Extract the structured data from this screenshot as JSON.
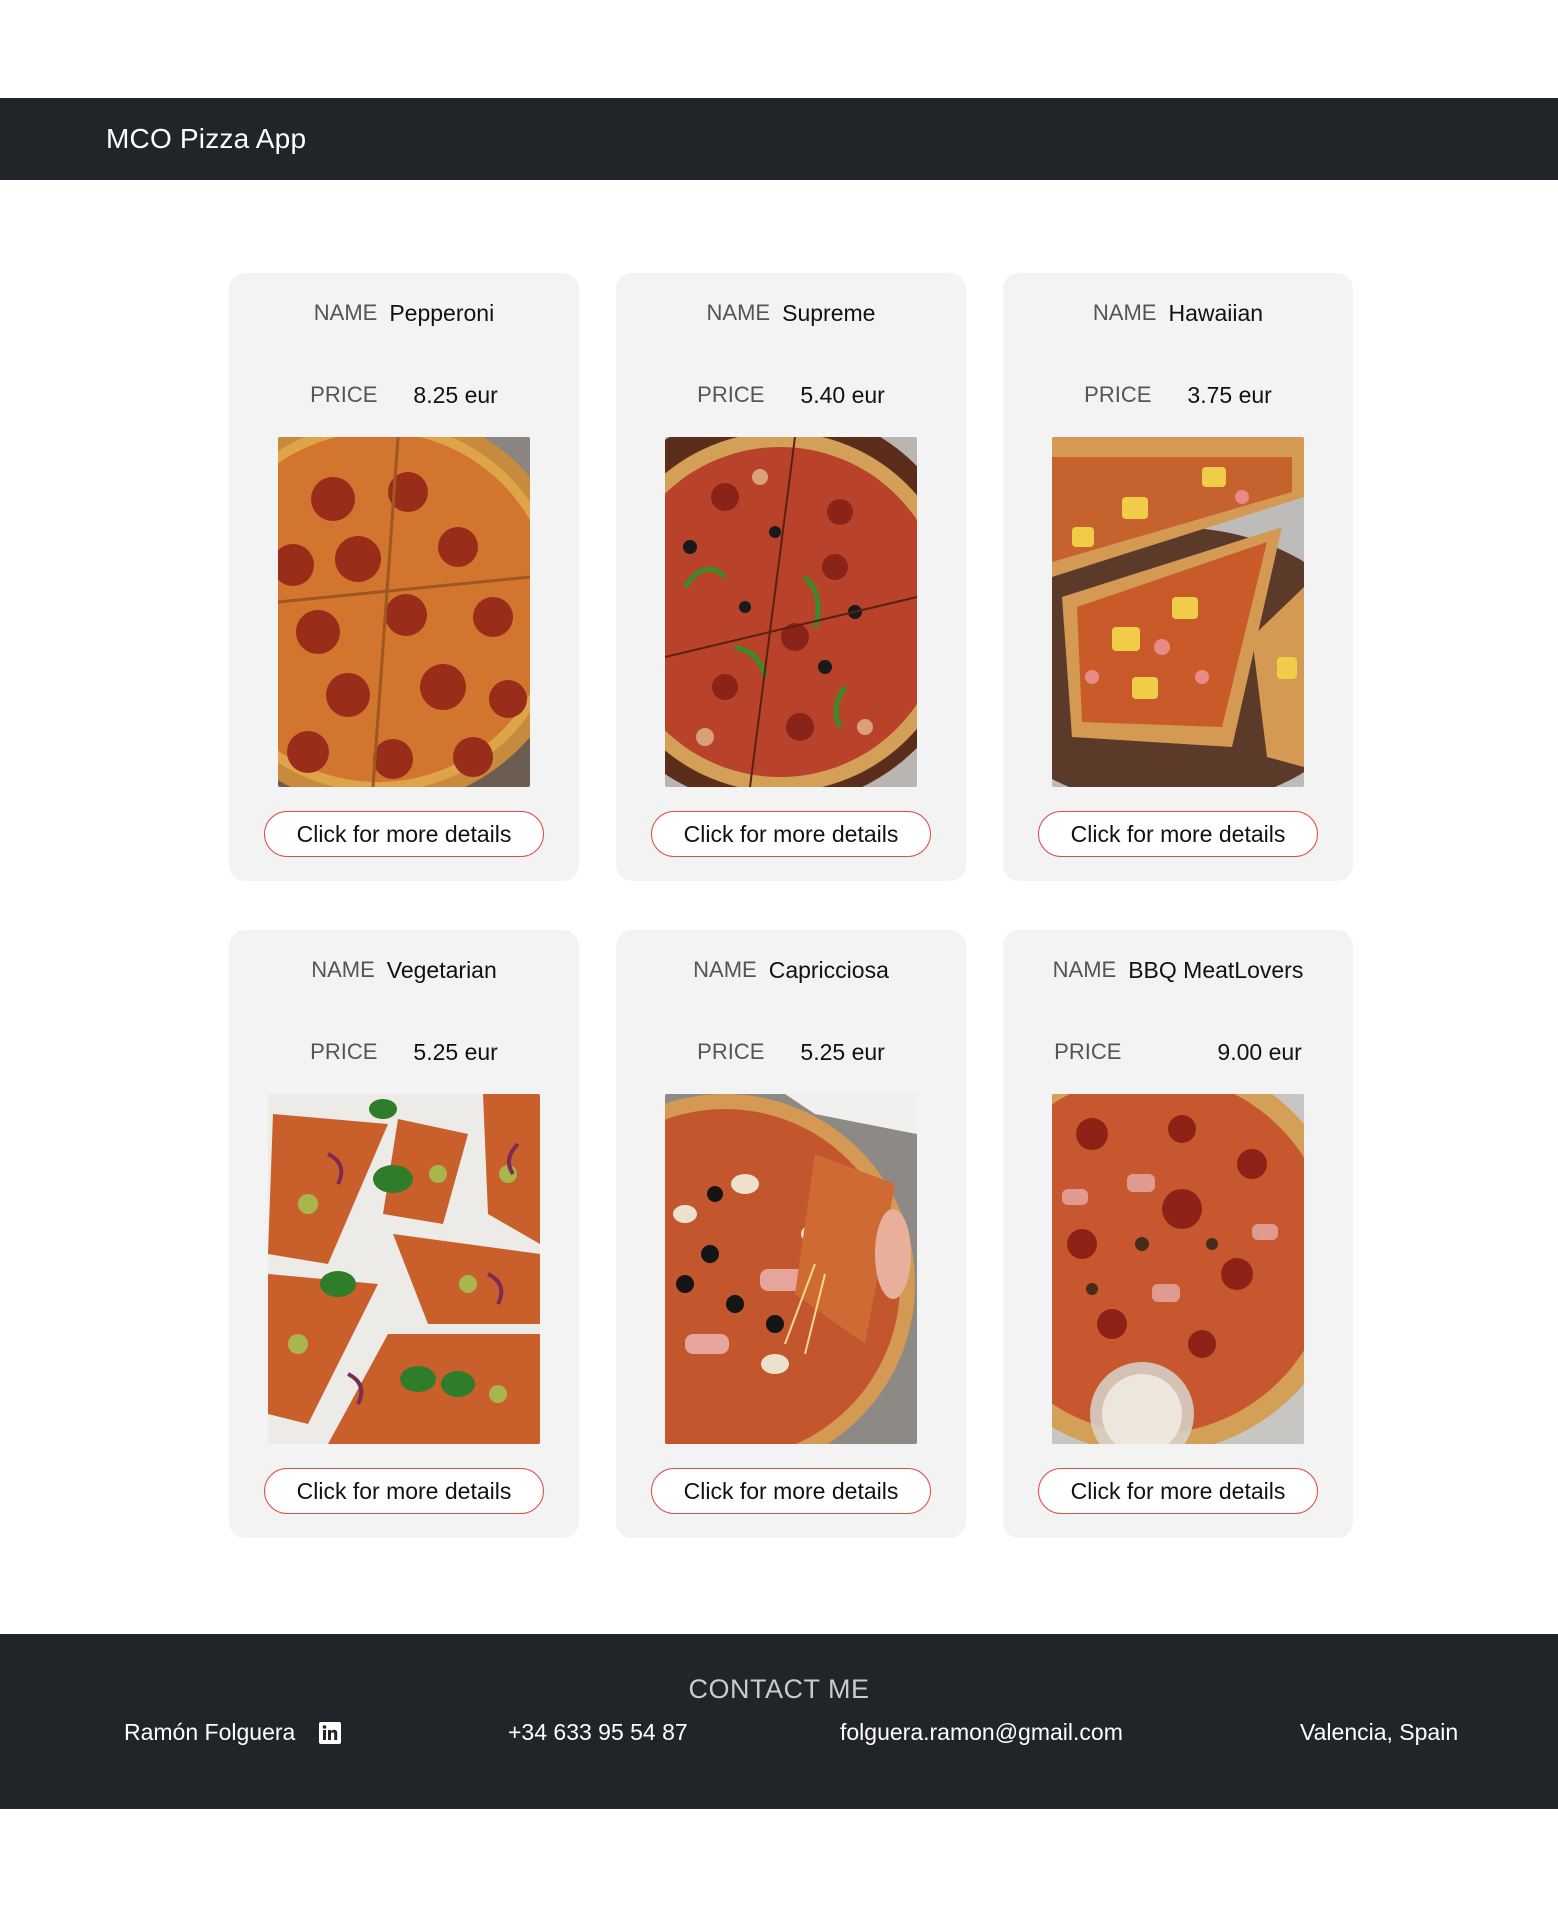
{
  "navbar": {
    "brand": "MCO Pizza App"
  },
  "labels": {
    "name": "NAME",
    "price": "PRICE"
  },
  "pizzas": [
    {
      "name": "Pepperoni",
      "price": "8.25 eur",
      "button": "Click for more details",
      "image": "pepperoni-pizza-photo"
    },
    {
      "name": "Supreme",
      "price": "5.40 eur",
      "button": "Click for more details",
      "image": "supreme-pizza-photo"
    },
    {
      "name": "Hawaiian",
      "price": "3.75 eur",
      "button": "Click for more details",
      "image": "hawaiian-pizza-photo"
    },
    {
      "name": "Vegetarian",
      "price": "5.25 eur",
      "button": "Click for more details",
      "image": "vegetarian-pizza-photo"
    },
    {
      "name": "Capricciosa",
      "price": "5.25 eur",
      "button": "Click for more details",
      "image": "capricciosa-pizza-photo"
    },
    {
      "name": "BBQ MeatLovers",
      "price": "9.00 eur",
      "button": "Click for more details",
      "image": "bbq-meatlovers-pizza-photo"
    }
  ],
  "footer": {
    "title": "CONTACT ME",
    "name": "Ramón Folguera",
    "linkedin_icon": "linkedin-icon",
    "phone": "+34 633 95 54 87",
    "email": "folguera.ramon@gmail.com",
    "location": "Valencia, Spain"
  },
  "colors": {
    "navbar_bg": "#212529",
    "card_bg": "#f3f3f3",
    "button_border": "#e14c4c"
  }
}
